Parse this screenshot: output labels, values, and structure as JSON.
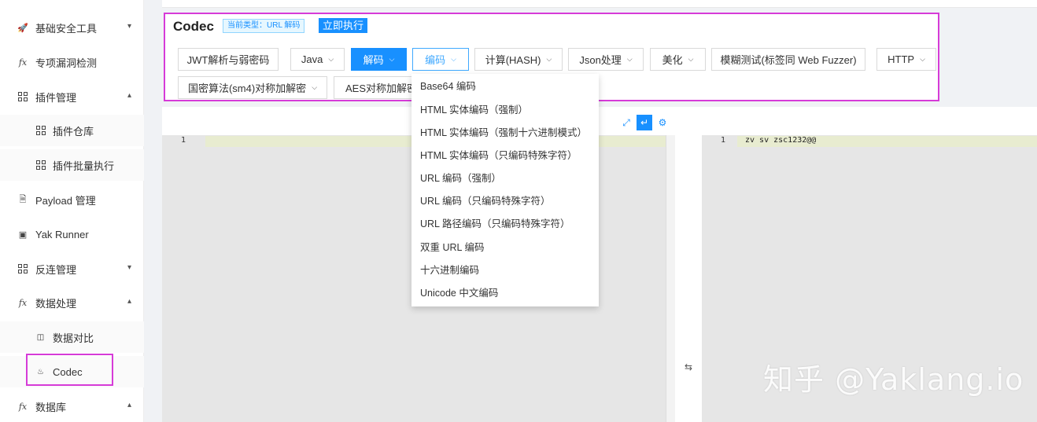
{
  "sidebar": {
    "items": [
      {
        "label": "基础安全工具",
        "icon": "rocket-icon",
        "arrow": "⌄"
      },
      {
        "label": "专项漏洞检测",
        "icon": "fx-icon"
      },
      {
        "label": "插件管理",
        "icon": "grid-icon",
        "arrow": "⌃"
      },
      {
        "label": "插件仓库",
        "icon": "grid-icon"
      },
      {
        "label": "插件批量执行",
        "icon": "grid-icon"
      },
      {
        "label": "Payload 管理",
        "icon": "document-icon"
      },
      {
        "label": "Yak Runner",
        "icon": "terminal-icon"
      },
      {
        "label": "反连管理",
        "icon": "grid-icon",
        "arrow": "⌄"
      },
      {
        "label": "数据处理",
        "icon": "fx-icon",
        "arrow": "⌃"
      },
      {
        "label": "数据对比",
        "icon": "compare-icon"
      },
      {
        "label": "Codec",
        "icon": "fire-icon"
      },
      {
        "label": "数据库",
        "icon": "fx-icon",
        "arrow": "⌃"
      }
    ]
  },
  "codec": {
    "title": "Codec",
    "type_tag": "当前类型：URL 解码",
    "run_label": "立即执行",
    "buttons": [
      {
        "label": "JWT解析与弱密码"
      },
      {
        "label": "Java"
      },
      {
        "label": "解码"
      },
      {
        "label": "编码"
      },
      {
        "label": "计算(HASH)"
      },
      {
        "label": "Json处理"
      },
      {
        "label": "美化"
      },
      {
        "label": "模糊测试(标签同 Web Fuzzer)"
      },
      {
        "label": "HTTP"
      },
      {
        "label": "国密算法(sm4)对称加解密"
      },
      {
        "label": "AES对称加解密"
      }
    ],
    "dropdown": [
      "Base64 编码",
      "HTML 实体编码（强制）",
      "HTML 实体编码（强制十六进制模式）",
      "HTML 实体编码（只编码特殊字符）",
      "URL 编码（强制）",
      "URL 编码（只编码特殊字符）",
      "URL 路径编码（只编码特殊字符）",
      "双重 URL 编码",
      "十六进制编码",
      "Unicode 中文编码"
    ]
  },
  "editor_left": {
    "line_no": "1",
    "content": ""
  },
  "editor_right": {
    "line_no": "1",
    "content": "zv sv zsc1232@@"
  },
  "watermark": "知乎 @Yaklang.io",
  "colors": {
    "accent": "#1890ff",
    "highlight": "#d63bd8"
  }
}
